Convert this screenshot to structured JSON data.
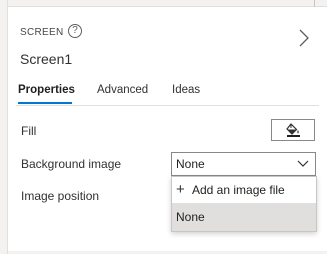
{
  "header": {
    "kind_label": "SCREEN",
    "help_glyph": "?",
    "screen_name": "Screen1"
  },
  "tabs": [
    {
      "label": "Properties",
      "active": true
    },
    {
      "label": "Advanced",
      "active": false
    },
    {
      "label": "Ideas",
      "active": false
    }
  ],
  "properties": {
    "fill": {
      "label": "Fill"
    },
    "background_image": {
      "label": "Background image",
      "value": "None"
    },
    "image_position": {
      "label": "Image position"
    }
  },
  "dropdown": {
    "items": [
      {
        "label": "Add an image file",
        "icon": "plus-icon"
      },
      {
        "label": "None",
        "selected": true
      }
    ]
  },
  "colors": {
    "accent": "#0078d4",
    "selected_item_bg": "#e1dfdd",
    "panel_bg": "#ffffff",
    "chrome_bg": "#f3f2f1"
  }
}
